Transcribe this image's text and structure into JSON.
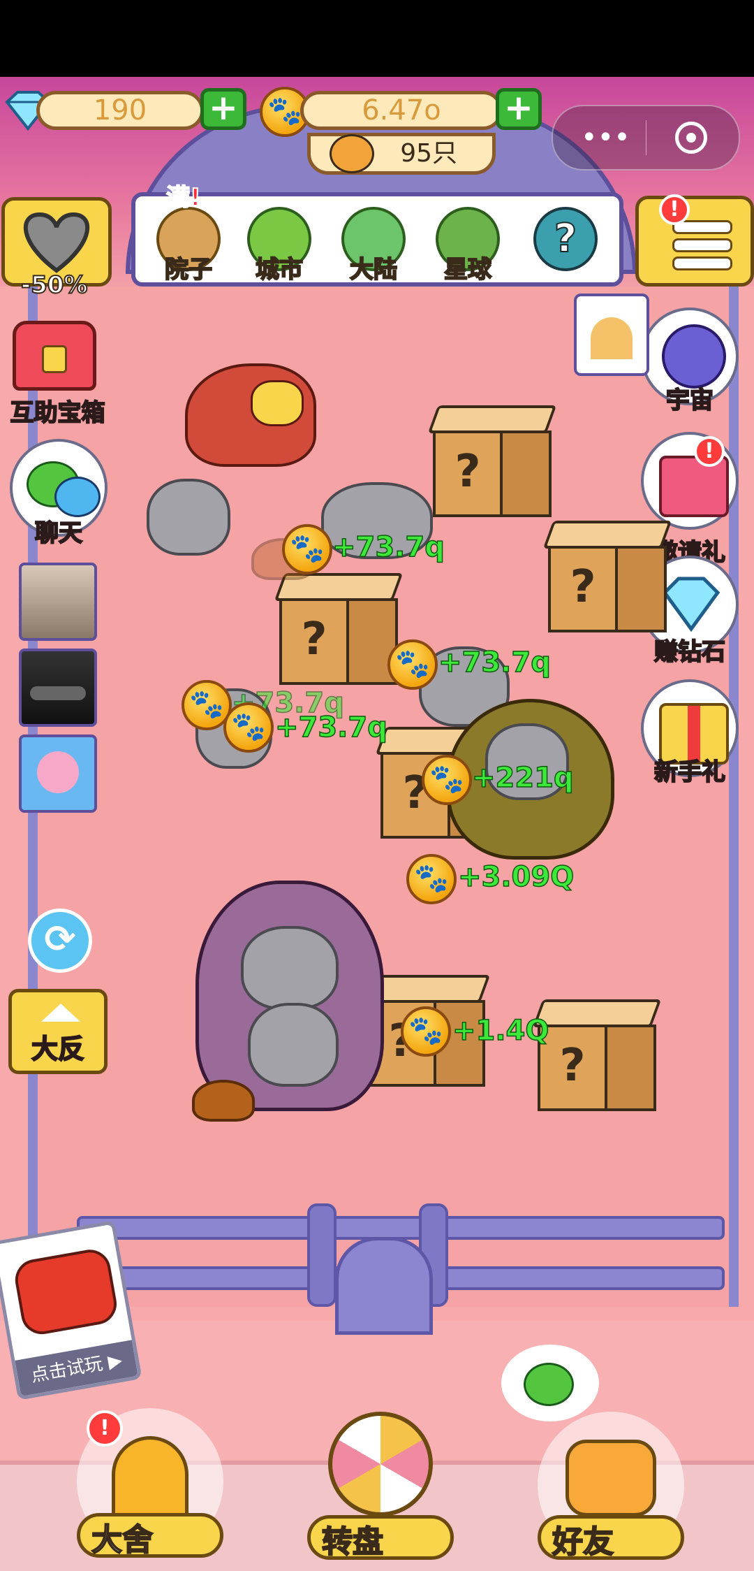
{
  "resources": {
    "diamonds": "190",
    "coins": "6.47o",
    "cats": "95只"
  },
  "tabs": [
    {
      "label": "院子",
      "color": "#d9a35a"
    },
    {
      "label": "城市",
      "color": "#7ac843"
    },
    {
      "label": "大陆",
      "color": "#6cc56a"
    },
    {
      "label": "星球",
      "color": "#6bb34a"
    },
    {
      "label": "?",
      "color": "#3c9fae"
    }
  ],
  "full_badge": "满!",
  "heart_label": "-50%",
  "left_buttons": {
    "treasure": "互助宝箱",
    "chat": "聊天",
    "enlarge": "大反"
  },
  "right_buttons": {
    "universe": "宇宙",
    "invite": "邀请礼",
    "earn_diamond": "赚钻石",
    "newbie_gift": "新手礼"
  },
  "earnings": [
    "+73.7q",
    "+73.7q",
    "+73.7q",
    "+73.7q",
    "+221q",
    "+3.09Q",
    "+1.4Q"
  ],
  "box_mark": "?",
  "ad": {
    "label": "点击试玩 ▶"
  },
  "bottom_nav": {
    "kennel": "大舍",
    "wheel": "转盘",
    "friends": "好友"
  },
  "badge_mark": "!",
  "plus_mark": "+",
  "colors": {
    "background": "#f8a9ac",
    "fence": "#8b86cf",
    "accent_yellow": "#f8d54a",
    "earning_green": "#3ee83a"
  }
}
